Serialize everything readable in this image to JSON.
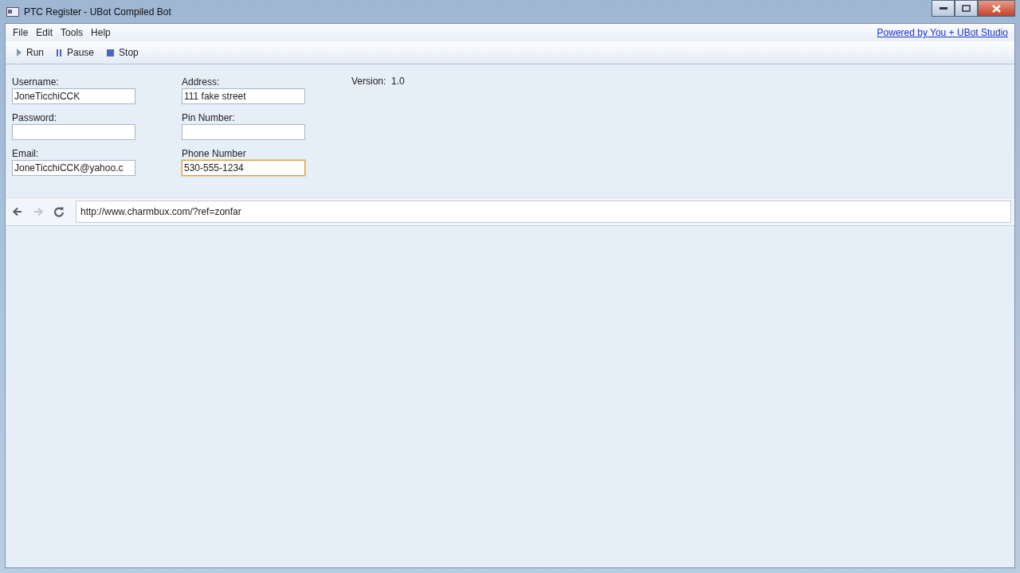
{
  "window": {
    "title": "PTC Register - UBot Compiled Bot"
  },
  "menu": [
    "File",
    "Edit",
    "Tools",
    "Help"
  ],
  "powered_link": "Powered by You + UBot Studio",
  "toolbar": [
    {
      "kind": "run",
      "label": "Run"
    },
    {
      "kind": "pause",
      "label": "Pause"
    },
    {
      "kind": "stop",
      "label": "Stop"
    }
  ],
  "form": {
    "columns": [
      [
        {
          "label": "Username:",
          "value": "JoneTicchiCCK",
          "focused": false
        },
        {
          "label": "Password:",
          "focused": false
        },
        {
          "label": "Email:",
          "value": "JoneTicchiCCK@yahoo.c",
          "focused": false
        }
      ],
      [
        {
          "label": "Address:",
          "value": "111 fake street",
          "focused": false
        },
        {
          "label": "Pin Number:",
          "focused": false
        },
        {
          "label": "Phone Number",
          "value": "530-555-1234",
          "focused": true
        }
      ]
    ],
    "version": "Version:  1.0"
  },
  "browser": {
    "nav": [
      {
        "kind": "back",
        "disabled": false
      },
      {
        "kind": "forward",
        "disabled": true
      },
      {
        "kind": "reload",
        "disabled": false
      }
    ],
    "url": "http://www.charmbux.com/?ref=zonfar"
  }
}
